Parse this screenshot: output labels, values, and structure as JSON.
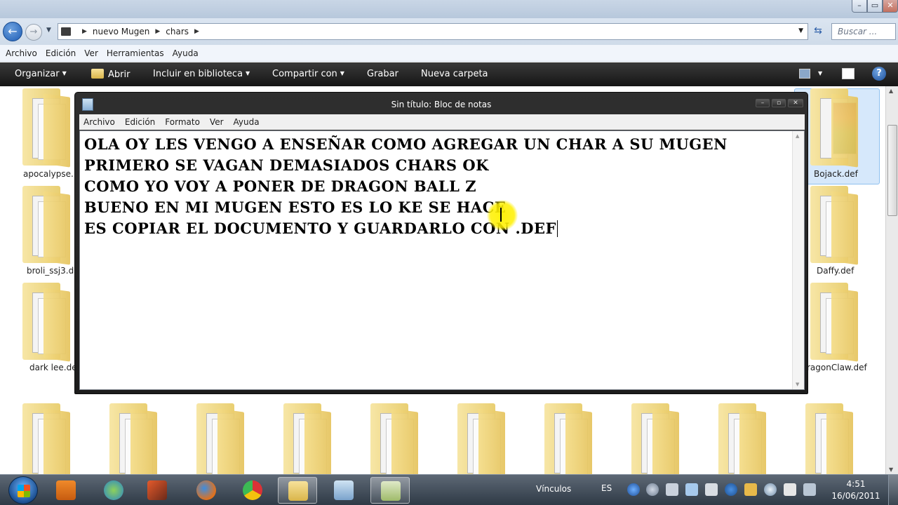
{
  "explorer": {
    "window_controls": {
      "minimize": "–",
      "maximize": "▭",
      "close": "✕"
    },
    "breadcrumb": [
      "nuevo Mugen",
      "chars"
    ],
    "search_placeholder": "Buscar ...",
    "menu": [
      "Archivo",
      "Edición",
      "Ver",
      "Herramientas",
      "Ayuda"
    ],
    "toolbar": {
      "organize": "Organizar",
      "open": "Abrir",
      "include": "Incluir en biblioteca",
      "share": "Compartir con",
      "burn": "Grabar",
      "new_folder": "Nueva carpeta"
    },
    "files": {
      "apocalypse": "apocalypse.",
      "bojack": "Bojack.def",
      "broli": "broli_ssj3.d",
      "daffy": "Daffy.def",
      "darklee": "dark lee.def",
      "dragonclaw": "ragonClaw.def",
      "partial": "def"
    }
  },
  "notepad": {
    "title": "Sin título: Bloc de notas",
    "menu": [
      "Archivo",
      "Edición",
      "Formato",
      "Ver",
      "Ayuda"
    ],
    "lines": [
      "OLA OY LES VENGO A ENSEÑAR COMO AGREGAR UN CHAR A SU MUGEN",
      "PRIMERO SE VAGAN DEMASIADOS CHARS OK",
      "COMO YO VOY A PONER DE DRAGON BALL Z",
      "BUENO EN MI MUGEN ESTO ES LO KE SE HACE",
      "ES COPIAR EL DOCUMENTO Y GUARDARLO CON .DEF"
    ]
  },
  "taskbar": {
    "links_label": "Vínculos",
    "language": "ES",
    "time": "4:51",
    "date": "16/06/2011"
  }
}
